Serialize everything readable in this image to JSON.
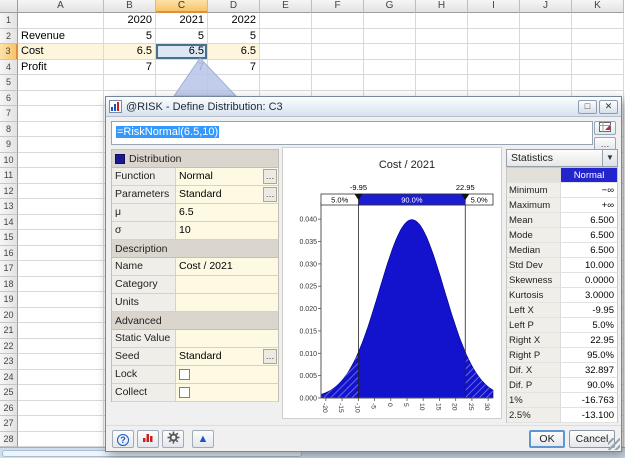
{
  "sheet": {
    "col_headers": [
      "A",
      "B",
      "C",
      "D",
      "E",
      "F",
      "G",
      "H",
      "I",
      "J",
      "K"
    ],
    "row_count": 28,
    "selected_col": "C",
    "selected_row": 3,
    "selected_cell": "C3",
    "cells": [
      {
        "col": "B",
        "row": 1,
        "v": "2020",
        "num": true
      },
      {
        "col": "C",
        "row": 1,
        "v": "2021",
        "num": true
      },
      {
        "col": "D",
        "row": 1,
        "v": "2022",
        "num": true
      },
      {
        "col": "A",
        "row": 2,
        "v": "Revenue"
      },
      {
        "col": "B",
        "row": 2,
        "v": "5",
        "num": true
      },
      {
        "col": "C",
        "row": 2,
        "v": "5",
        "num": true
      },
      {
        "col": "D",
        "row": 2,
        "v": "5",
        "num": true
      },
      {
        "col": "A",
        "row": 3,
        "v": "Cost",
        "shaded": true
      },
      {
        "col": "B",
        "row": 3,
        "v": "6.5",
        "num": true,
        "shaded": true
      },
      {
        "col": "C",
        "row": 3,
        "v": "6.5",
        "num": true,
        "selected": true
      },
      {
        "col": "D",
        "row": 3,
        "v": "6.5",
        "num": true,
        "shaded": true
      },
      {
        "col": "A",
        "row": 4,
        "v": "Profit"
      },
      {
        "col": "B",
        "row": 4,
        "v": "7",
        "num": true
      },
      {
        "col": "C",
        "row": 4,
        "v": "7",
        "num": true
      },
      {
        "col": "D",
        "row": 4,
        "v": "7",
        "num": true
      }
    ]
  },
  "dialog": {
    "title": "@RISK - Define Distribution: C3",
    "window_buttons": {
      "maximize": "□",
      "close": "✕"
    },
    "formula": "=RiskNormal(6.5,10)",
    "panel": {
      "sections": [
        {
          "header": "Distribution",
          "rows": [
            {
              "label": "Function",
              "value": "Normal",
              "more": true
            },
            {
              "label": "Parameters",
              "value": "Standard",
              "more": true
            },
            {
              "label": "μ",
              "value": "6.5"
            },
            {
              "label": "σ",
              "value": "10"
            }
          ]
        },
        {
          "header": "Description",
          "rows": [
            {
              "label": "Name",
              "value": "Cost / 2021"
            },
            {
              "label": "Category",
              "value": ""
            },
            {
              "label": "Units",
              "value": ""
            }
          ]
        },
        {
          "header": "Advanced",
          "rows": [
            {
              "label": "Static Value",
              "value": ""
            },
            {
              "label": "Seed",
              "value": "Standard",
              "more": true
            },
            {
              "label": "Lock",
              "checkbox": true
            },
            {
              "label": "Collect",
              "checkbox": true
            }
          ]
        }
      ]
    },
    "statistics": {
      "title": "Statistics",
      "column_header": "Normal",
      "rows": [
        {
          "label": "Minimum",
          "value": "−∞"
        },
        {
          "label": "Maximum",
          "value": "+∞"
        },
        {
          "label": "Mean",
          "value": "6.500"
        },
        {
          "label": "Mode",
          "value": "6.500"
        },
        {
          "label": "Median",
          "value": "6.500"
        },
        {
          "label": "Std Dev",
          "value": "10.000"
        },
        {
          "label": "Skewness",
          "value": "0.0000"
        },
        {
          "label": "Kurtosis",
          "value": "3.0000"
        },
        {
          "label": "Left X",
          "value": "-9.95"
        },
        {
          "label": "Left P",
          "value": "5.0%"
        },
        {
          "label": "Right X",
          "value": "22.95"
        },
        {
          "label": "Right P",
          "value": "95.0%"
        },
        {
          "label": "Dif. X",
          "value": "32.897"
        },
        {
          "label": "Dif. P",
          "value": "90.0%"
        },
        {
          "label": "1%",
          "value": "-16.763"
        },
        {
          "label": "2.5%",
          "value": "-13.100"
        }
      ]
    },
    "footer": {
      "ok": "OK",
      "cancel": "Cancel"
    }
  },
  "chart_data": {
    "type": "area",
    "title": "Cost / 2021",
    "distribution": "normal",
    "mean": 6.5,
    "std_dev": 10,
    "xlim": [
      -21.5,
      31.5
    ],
    "ylim": [
      0,
      0.0425
    ],
    "x_ticks": [
      -20,
      -15,
      -10,
      -5,
      0,
      5,
      10,
      15,
      20,
      25,
      30
    ],
    "y_ticks": [
      "0.000",
      "0.005",
      "0.010",
      "0.015",
      "0.020",
      "0.025",
      "0.030",
      "0.035",
      "0.040"
    ],
    "delimiter_left": {
      "x": -9.95,
      "label": "-9.95",
      "p": "5.0%"
    },
    "delimiter_right": {
      "x": 22.95,
      "label": "22.95",
      "p": "5.0%"
    },
    "center_p": "90.0%",
    "curve_color": "#1313ce"
  }
}
